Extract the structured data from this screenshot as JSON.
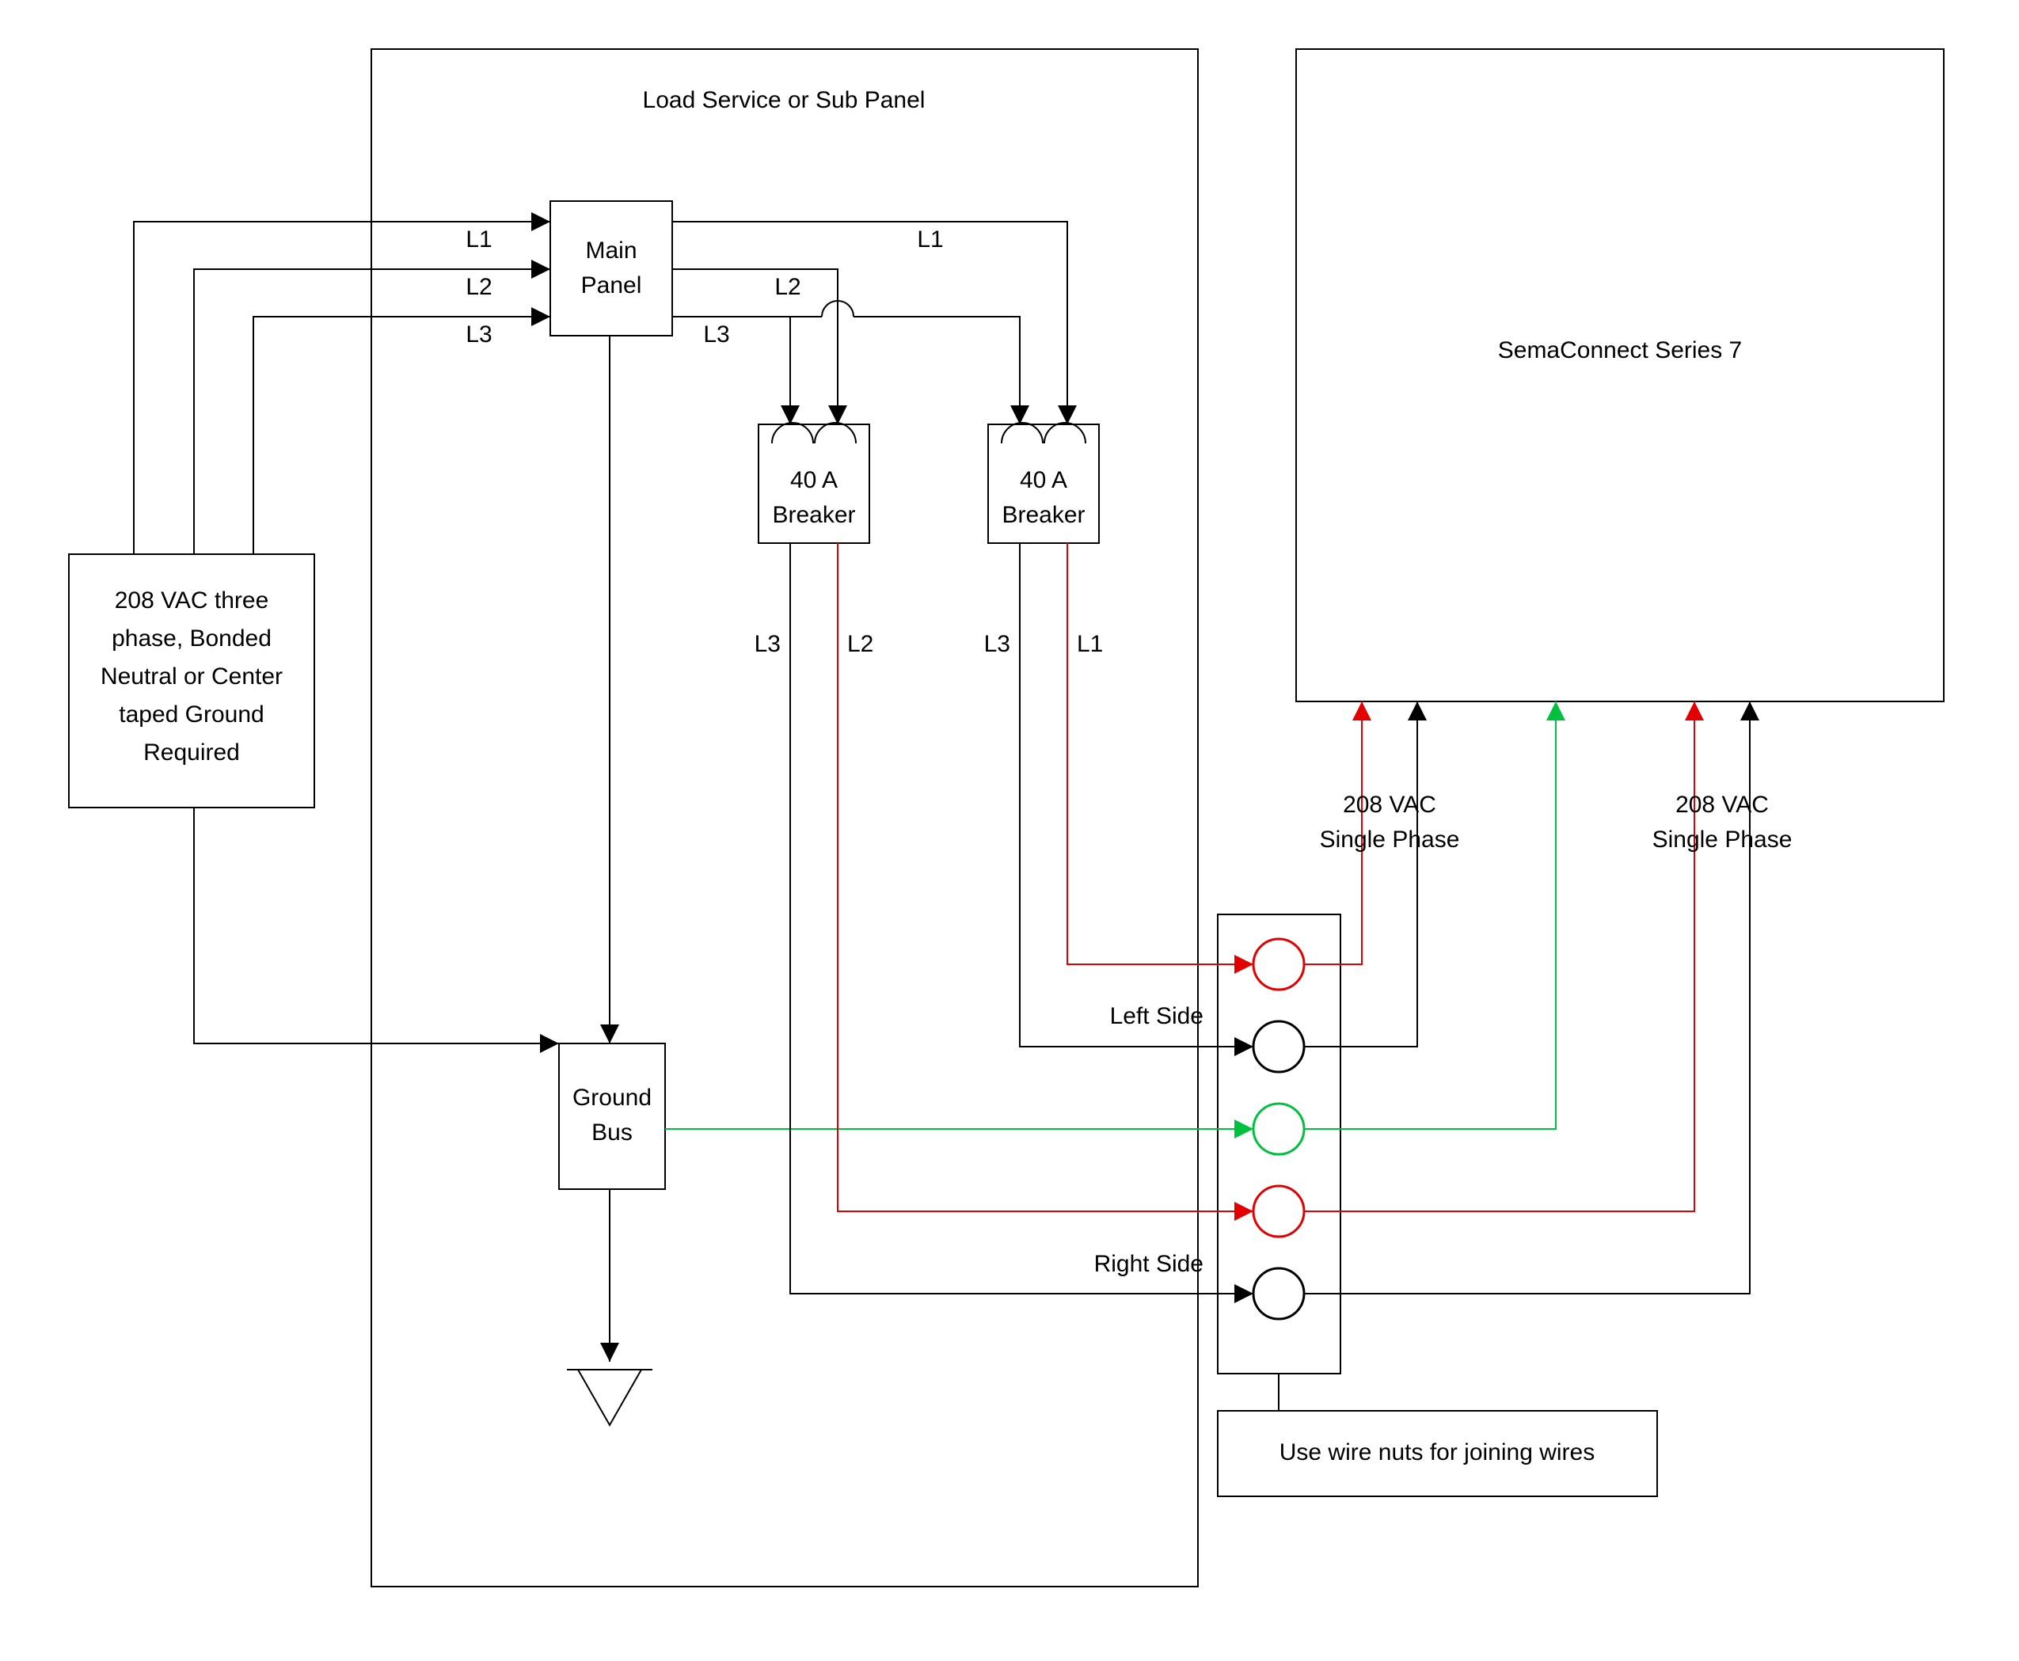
{
  "panel_title": "Load Service or Sub Panel",
  "source_box": {
    "line1": "208 VAC three",
    "line2": "phase, Bonded",
    "line3": "Neutral or Center",
    "line4": "taped Ground",
    "line5": "Required"
  },
  "phase_labels": {
    "L1": "L1",
    "L2": "L2",
    "L3": "L3"
  },
  "main_panel": {
    "line1": "Main",
    "line2": "Panel"
  },
  "breaker1": {
    "line1": "40 A",
    "line2": "Breaker"
  },
  "breaker2": {
    "line1": "40 A",
    "line2": "Breaker"
  },
  "breaker_outputs": {
    "b1_left": "L3",
    "b1_right": "L2",
    "b2_left": "L3",
    "b2_right": "L1"
  },
  "ground_bus": {
    "line1": "Ground",
    "line2": "Bus"
  },
  "side_labels": {
    "left": "Left Side",
    "right": "Right Side"
  },
  "output_labels": {
    "out1": "208 VAC",
    "out1b": "Single Phase",
    "out2": "208 VAC",
    "out2b": "Single Phase"
  },
  "device_box": "SemaConnect Series 7",
  "note_box": "Use wire nuts for joining wires"
}
